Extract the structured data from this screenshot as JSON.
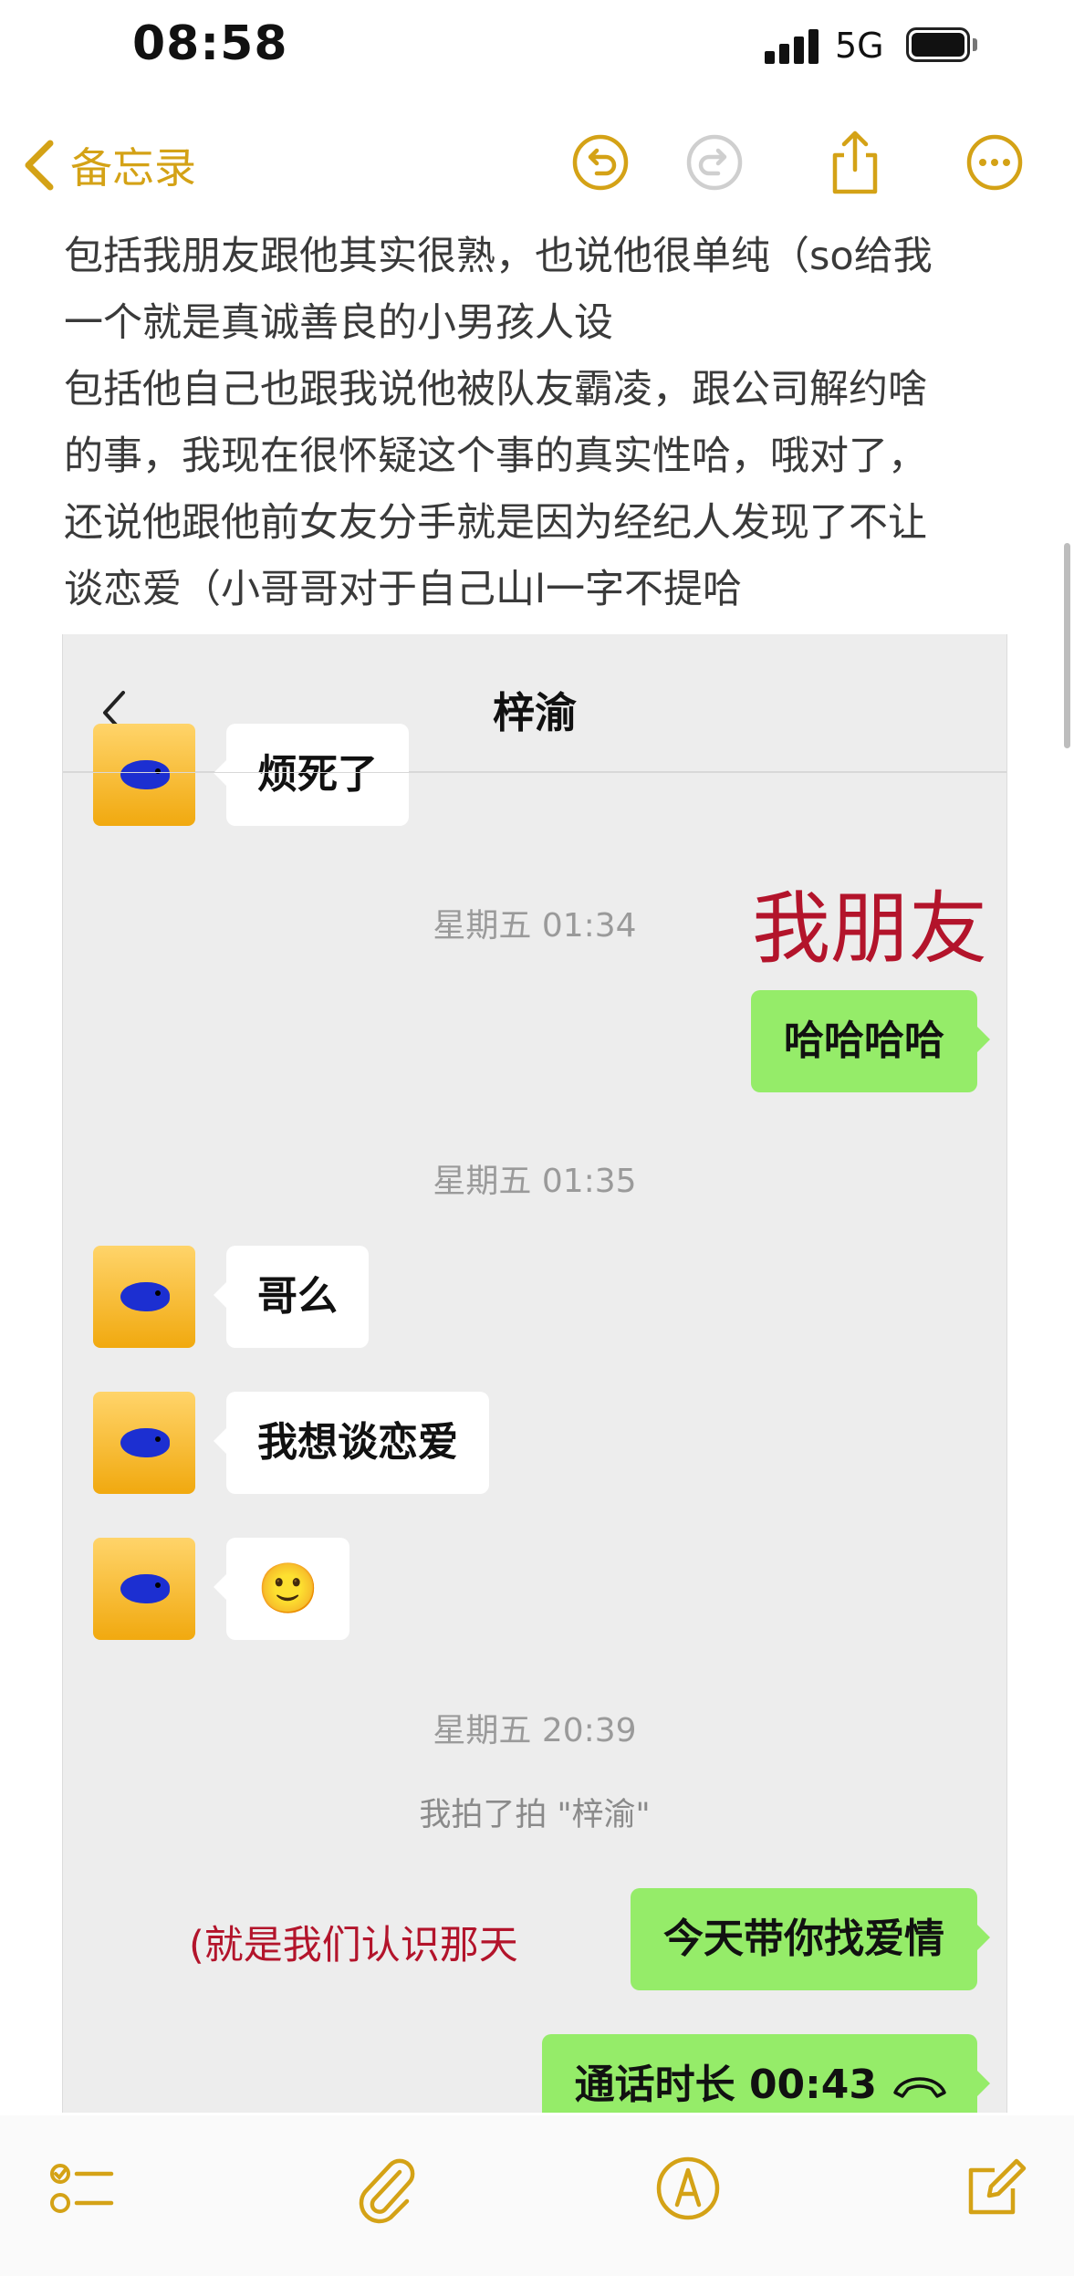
{
  "status_bar": {
    "time": "08:58",
    "network": "5G"
  },
  "navbar": {
    "back_label": "备忘录"
  },
  "note": {
    "lines": [
      "包括我朋友跟他其实很熟，也说他很单纯（so给我",
      "一个就是真诚善良的小男孩人设",
      "包括他自己也跟我说他被队友霸凌，跟公司解约啥",
      "的事，我现在很怀疑这个事的真实性哈，哦对了，",
      "还说他跟他前女友分手就是因为经纪人发现了不让",
      "谈恋爱（小哥哥对于自己山l一字不提哈"
    ]
  },
  "chat": {
    "title": "梓渝",
    "messages": [
      {
        "side": "left",
        "text": "烦死了"
      },
      {
        "type": "time",
        "text": "星期五 01:34"
      },
      {
        "type": "annotation",
        "text": "我朋友"
      },
      {
        "side": "right",
        "text": "哈哈哈哈"
      },
      {
        "type": "time",
        "text": "星期五 01:35"
      },
      {
        "side": "left",
        "text": "哥么"
      },
      {
        "side": "left",
        "text": "我想谈恋爱"
      },
      {
        "side": "left",
        "text": "🙂"
      },
      {
        "type": "time",
        "text": "星期五 20:39"
      },
      {
        "type": "system",
        "text": "我拍了拍 \"梓渝\""
      },
      {
        "type": "annotation",
        "text": "(就是我们认识那天"
      },
      {
        "side": "right",
        "text": "今天带你找爱情"
      },
      {
        "side": "right",
        "text": "通话时长 00:43"
      }
    ]
  },
  "colors": {
    "accent": "#d4a216",
    "wechat_green": "#95ec69",
    "annotation_red": "#b3142b"
  }
}
